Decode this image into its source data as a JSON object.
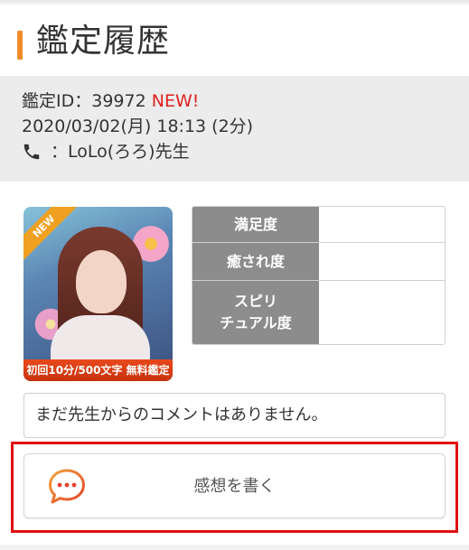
{
  "page": {
    "title": "鑑定履歴",
    "accent_color": "#ef8a2a"
  },
  "info": {
    "id_label": "鑑定ID：39972",
    "new_badge": "NEW!",
    "datetime": "2020/03/02(月) 18:13 (2分)",
    "phone_icon": "phone-icon",
    "separator": "：",
    "advisor": "LoLo(ろろ)先生"
  },
  "photo": {
    "ribbon": "NEW",
    "caption": "初回10分/500文字 無料鑑定"
  },
  "ratings": [
    {
      "label": "満足度",
      "value": ""
    },
    {
      "label": "癒され度",
      "value": ""
    },
    {
      "label_line1": "スピリ",
      "label_line2": "チュアル度",
      "value": ""
    }
  ],
  "comment": {
    "text": "まだ先生からのコメントはありません。"
  },
  "review_button": {
    "icon": "chat-bubble-icon",
    "label": "感想を書く"
  },
  "colors": {
    "new": "#e02020",
    "highlight": "#e01010",
    "rating_header": "#8c8c8c"
  }
}
